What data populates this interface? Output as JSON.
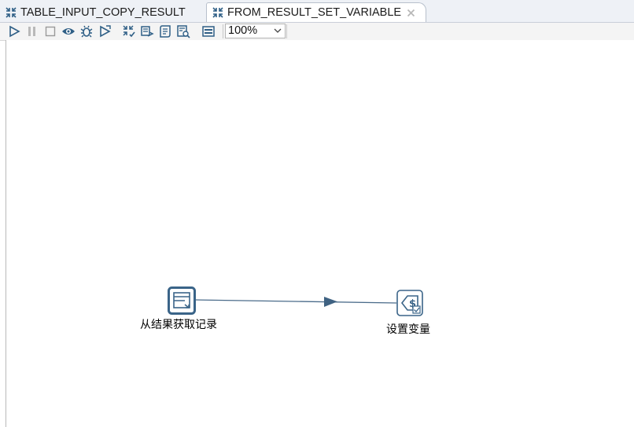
{
  "tabs": [
    {
      "label": "TABLE_INPUT_COPY_RESULT",
      "icon": "transformation-icon",
      "active": false
    },
    {
      "label": "FROM_RESULT_SET_VARIABLE",
      "icon": "transformation-icon",
      "active": true
    }
  ],
  "toolbar": {
    "buttons": [
      "run-icon",
      "pause-icon",
      "stop-icon",
      "preview-icon",
      "debug-icon",
      "replay-icon",
      "verify-icon",
      "impact-icon",
      "sql-icon",
      "explore-db-icon",
      "show-results-icon"
    ],
    "zoom_value": "100%"
  },
  "canvas": {
    "steps": [
      {
        "label": "从结果获取记录",
        "icon": "get-rows-from-result-icon"
      },
      {
        "label": "设置变量",
        "icon": "set-variables-icon"
      }
    ],
    "hop_color": "#4a6b8a"
  }
}
